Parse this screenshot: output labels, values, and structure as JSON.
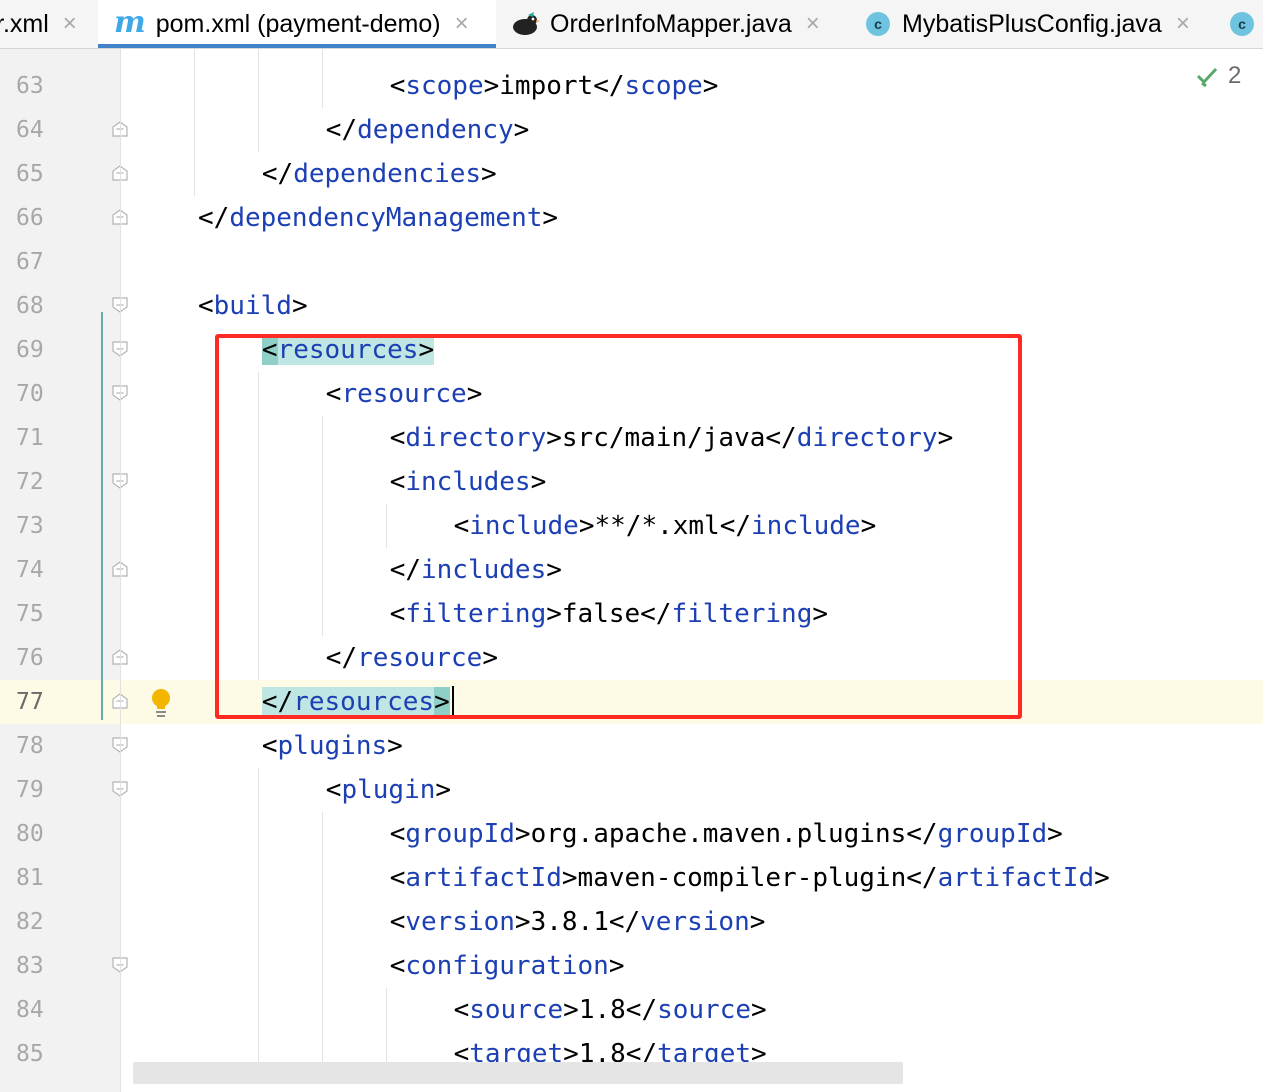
{
  "tabs": [
    {
      "label": "r.xml",
      "active": false
    },
    {
      "label": "pom.xml (payment-demo)",
      "icon": "maven-icon",
      "active": true
    },
    {
      "label": "OrderInfoMapper.java",
      "icon": "mybatis-bird-icon",
      "active": false
    },
    {
      "label": "MybatisPlusConfig.java",
      "icon": "class-icon",
      "active": false
    },
    {
      "label": "",
      "icon": "class-icon",
      "active": false
    }
  ],
  "close_glyph": "×",
  "class_icon_letter": "c",
  "inspection": {
    "count": "2",
    "icon": "check-double-icon"
  },
  "colors": {
    "tag": "#1c3fb4",
    "text": "#000000",
    "highlight": "#bfe6e2",
    "annotation_box": "#ff2a22",
    "current_line": "#fdfbe6"
  },
  "editor": {
    "current_line": "77",
    "lines": [
      {
        "num": "63",
        "indent": 3,
        "tokens": [
          {
            "t": "<"
          },
          {
            "t": "scope",
            "k": "tag"
          },
          {
            "t": ">import</"
          },
          {
            "t": "scope",
            "k": "tag"
          },
          {
            "t": ">"
          }
        ]
      },
      {
        "num": "64",
        "indent": 2,
        "tokens": [
          {
            "t": "</"
          },
          {
            "t": "dependency",
            "k": "tag"
          },
          {
            "t": ">"
          }
        ]
      },
      {
        "num": "65",
        "indent": 1,
        "tokens": [
          {
            "t": "</"
          },
          {
            "t": "dependencies",
            "k": "tag"
          },
          {
            "t": ">"
          }
        ]
      },
      {
        "num": "66",
        "indent": 0,
        "tokens": [
          {
            "t": "</"
          },
          {
            "t": "dependencyManagement",
            "k": "tag"
          },
          {
            "t": ">"
          }
        ]
      },
      {
        "num": "67",
        "indent": 0,
        "tokens": []
      },
      {
        "num": "68",
        "indent": 0,
        "tokens": [
          {
            "t": "<"
          },
          {
            "t": "build",
            "k": "tag"
          },
          {
            "t": ">"
          }
        ]
      },
      {
        "num": "69",
        "indent": 1,
        "tokens": [
          {
            "t": "<",
            "h": "br"
          },
          {
            "t": "resources",
            "k": "tag",
            "h": "hl"
          },
          {
            "t": ">",
            "h": "hl"
          }
        ]
      },
      {
        "num": "70",
        "indent": 2,
        "tokens": [
          {
            "t": "<"
          },
          {
            "t": "resource",
            "k": "tag"
          },
          {
            "t": ">"
          }
        ]
      },
      {
        "num": "71",
        "indent": 3,
        "tokens": [
          {
            "t": "<"
          },
          {
            "t": "directory",
            "k": "tag"
          },
          {
            "t": ">src/main/java</"
          },
          {
            "t": "directory",
            "k": "tag"
          },
          {
            "t": ">"
          }
        ]
      },
      {
        "num": "72",
        "indent": 3,
        "tokens": [
          {
            "t": "<"
          },
          {
            "t": "includes",
            "k": "tag"
          },
          {
            "t": ">"
          }
        ]
      },
      {
        "num": "73",
        "indent": 4,
        "tokens": [
          {
            "t": "<"
          },
          {
            "t": "include",
            "k": "tag"
          },
          {
            "t": ">**/*.xml</"
          },
          {
            "t": "include",
            "k": "tag"
          },
          {
            "t": ">"
          }
        ]
      },
      {
        "num": "74",
        "indent": 3,
        "tokens": [
          {
            "t": "</"
          },
          {
            "t": "includes",
            "k": "tag"
          },
          {
            "t": ">"
          }
        ]
      },
      {
        "num": "75",
        "indent": 3,
        "tokens": [
          {
            "t": "<"
          },
          {
            "t": "filtering",
            "k": "tag"
          },
          {
            "t": ">false</"
          },
          {
            "t": "filtering",
            "k": "tag"
          },
          {
            "t": ">"
          }
        ]
      },
      {
        "num": "76",
        "indent": 2,
        "tokens": [
          {
            "t": "</"
          },
          {
            "t": "resource",
            "k": "tag"
          },
          {
            "t": ">"
          }
        ]
      },
      {
        "num": "77",
        "indent": 1,
        "tokens": [
          {
            "t": "</",
            "h": "hl"
          },
          {
            "t": "resources",
            "k": "tag",
            "h": "hl"
          },
          {
            "t": ">",
            "h": "br"
          }
        ]
      },
      {
        "num": "78",
        "indent": 1,
        "tokens": [
          {
            "t": "<"
          },
          {
            "t": "plugins",
            "k": "tag"
          },
          {
            "t": ">"
          }
        ]
      },
      {
        "num": "79",
        "indent": 2,
        "tokens": [
          {
            "t": "<"
          },
          {
            "t": "plugin",
            "k": "tag"
          },
          {
            "t": ">"
          }
        ]
      },
      {
        "num": "80",
        "indent": 3,
        "tokens": [
          {
            "t": "<"
          },
          {
            "t": "groupId",
            "k": "tag"
          },
          {
            "t": ">org.apache.maven.plugins</"
          },
          {
            "t": "groupId",
            "k": "tag"
          },
          {
            "t": ">"
          }
        ]
      },
      {
        "num": "81",
        "indent": 3,
        "tokens": [
          {
            "t": "<"
          },
          {
            "t": "artifactId",
            "k": "tag"
          },
          {
            "t": ">maven-compiler-plugin</"
          },
          {
            "t": "artifactId",
            "k": "tag"
          },
          {
            "t": ">"
          }
        ]
      },
      {
        "num": "82",
        "indent": 3,
        "tokens": [
          {
            "t": "<"
          },
          {
            "t": "version",
            "k": "tag"
          },
          {
            "t": ">3.8.1</"
          },
          {
            "t": "version",
            "k": "tag"
          },
          {
            "t": ">"
          }
        ]
      },
      {
        "num": "83",
        "indent": 3,
        "tokens": [
          {
            "t": "<"
          },
          {
            "t": "configuration",
            "k": "tag"
          },
          {
            "t": ">"
          }
        ]
      },
      {
        "num": "84",
        "indent": 4,
        "tokens": [
          {
            "t": "<"
          },
          {
            "t": "source",
            "k": "tag"
          },
          {
            "t": ">1.8</"
          },
          {
            "t": "source",
            "k": "tag"
          },
          {
            "t": ">"
          }
        ]
      },
      {
        "num": "85",
        "indent": 4,
        "tokens": [
          {
            "t": "<"
          },
          {
            "t": "target",
            "k": "tag"
          },
          {
            "t": ">1.8</"
          },
          {
            "t": "target",
            "k": "tag"
          },
          {
            "t": ">"
          }
        ]
      }
    ]
  }
}
